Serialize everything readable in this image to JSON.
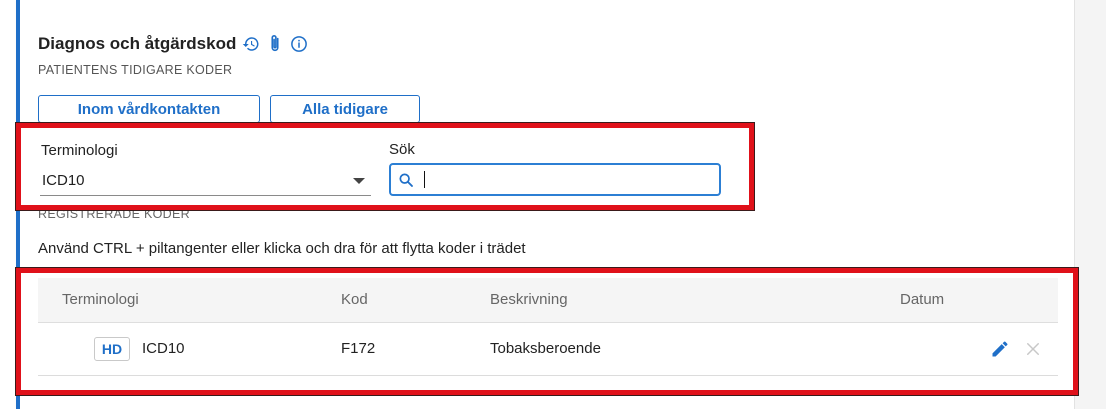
{
  "header": {
    "title": "Diagnos och åtgärdskod",
    "icons": [
      "history-icon",
      "paperclip-icon",
      "info-icon"
    ],
    "subheading": "PATIENTENS TIDIGARE KODER"
  },
  "filter_buttons": {
    "within_contact": "Inom vårdkontakten",
    "all_previous": "Alla tidigare"
  },
  "form": {
    "terminology_label": "Terminologi",
    "terminology_value": "ICD10",
    "search_label": "Sök",
    "search_value": ""
  },
  "registered": {
    "section_label": "REGISTRERADE KODER",
    "hint": "Använd CTRL + piltangenter eller klicka och dra för att flytta koder i trädet",
    "columns": [
      "Terminologi",
      "Kod",
      "Beskrivning",
      "Datum"
    ],
    "rows": [
      {
        "badge": "HD",
        "terminology": "ICD10",
        "code": "F172",
        "description": "Tobaksberoende",
        "date": ""
      }
    ]
  },
  "colors": {
    "accent": "#1f6fc8",
    "highlight": "#e0111a",
    "focus_border": "#2c7fd4"
  }
}
